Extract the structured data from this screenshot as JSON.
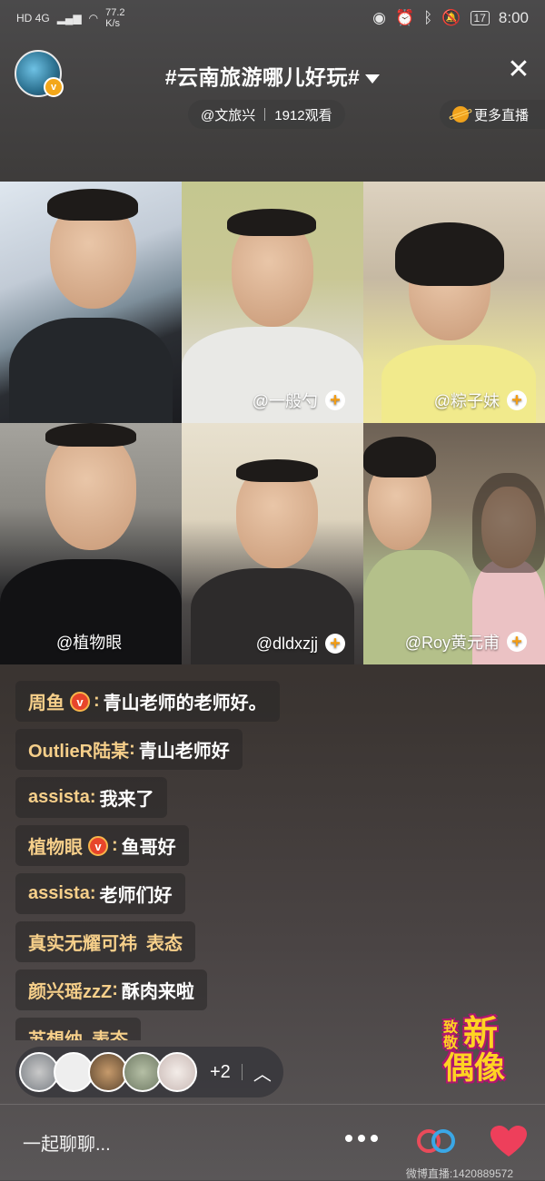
{
  "status_bar": {
    "left": "HD 4G",
    "speed": "77.2",
    "speed_unit": "K/s",
    "battery": "17",
    "time": "8:00"
  },
  "header": {
    "topic": "#云南旅游哪儿好玩#",
    "host": "@文旅兴",
    "viewers": "1912观看",
    "more_live": "更多直播"
  },
  "participants": [
    {
      "handle": ""
    },
    {
      "handle": "@一般勺"
    },
    {
      "handle": "@粽子妹"
    },
    {
      "handle": "@植物眼"
    },
    {
      "handle": "@dldxzjj"
    },
    {
      "handle": "@Roy黄元甫"
    }
  ],
  "chat": [
    {
      "user": "周鱼",
      "text": "青山老师的老师好。"
    },
    {
      "user": "OutlieR陆某",
      "text": "青山老师好"
    },
    {
      "user": "assista",
      "text": "我来了"
    },
    {
      "user": "植物眼",
      "text": "鱼哥好"
    },
    {
      "user": "assista",
      "text": "老师们好"
    },
    {
      "user": "真实无耀可祎",
      "text": "表态"
    },
    {
      "user": "颜兴瑶zzZ",
      "text": "酥肉来啦"
    },
    {
      "user": "苏想纳",
      "text": "表态"
    }
  ],
  "viewer_strip": {
    "extra": "+2"
  },
  "badge": {
    "line1": "致敬",
    "line2": "新",
    "line3": "偶像"
  },
  "bottom": {
    "chat_placeholder": "一起聊聊...",
    "watermark": "微博直播:1420889572"
  }
}
